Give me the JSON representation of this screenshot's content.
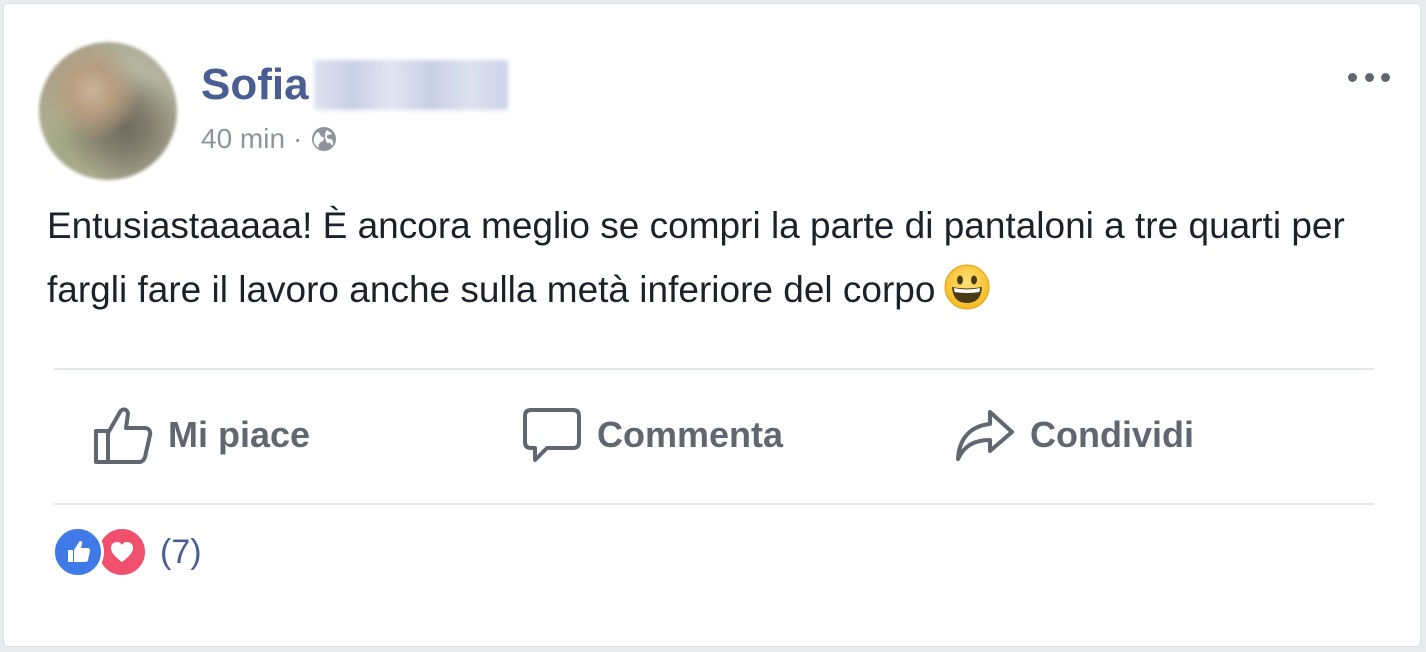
{
  "post": {
    "author_name": "Sofia",
    "timestamp": "40 min",
    "separator": "·",
    "privacy_icon": "globe-icon",
    "text": "Entusiastaaaaa! È ancora meglio se compri la parte di pantaloni a tre quarti per fargli fare il lavoro anche sulla metà inferiore del corpo",
    "emoji": "grinning-face-emoji"
  },
  "actions": {
    "like_label": "Mi piace",
    "comment_label": "Commenta",
    "share_label": "Condividi"
  },
  "reactions": {
    "icons": [
      "like-reaction-icon",
      "love-reaction-icon"
    ],
    "count": "(7)"
  },
  "colors": {
    "author": "#4b5e94",
    "action_text": "#616770",
    "like_blue": "#3f7ae6",
    "love_red": "#f0506e"
  }
}
